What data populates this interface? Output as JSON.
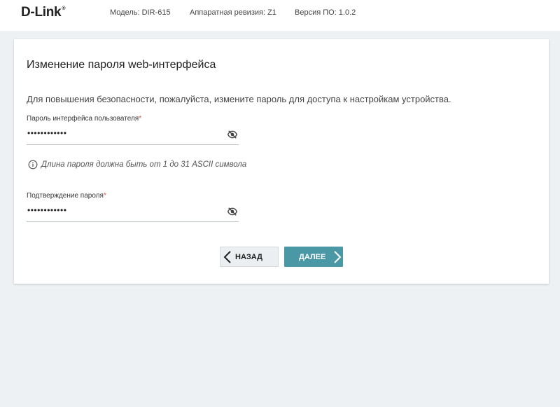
{
  "header": {
    "logo": "D-Link",
    "logo_mark": "®",
    "model": "Модель: DIR-615",
    "hw_revision": "Аппаратная ревизия: Z1",
    "fw_version": "Версия ПО: 1.0.2"
  },
  "form": {
    "title": "Изменение пароля web-интерфейса",
    "description": "Для повышения безопасности, пожалуйста, измените пароль для доступа к настройкам устройства.",
    "password": {
      "label": "Пароль интерфейса пользователя",
      "required_mark": "*",
      "value": "••••••••••••",
      "icon": "eye-off-icon"
    },
    "hint": {
      "icon": "info-icon",
      "text": "Длина пароля должна быть от 1 до 31 ASCII символа"
    },
    "confirm": {
      "label": "Подтверждение пароля",
      "required_mark": "*",
      "value": "••••••••••••",
      "icon": "eye-off-icon"
    }
  },
  "buttons": {
    "back_label": "НАЗАД",
    "next_label": "ДАЛЕЕ"
  },
  "colors": {
    "accent": "#4a97a6",
    "required": "#d9534f",
    "background": "#eef1f3"
  }
}
